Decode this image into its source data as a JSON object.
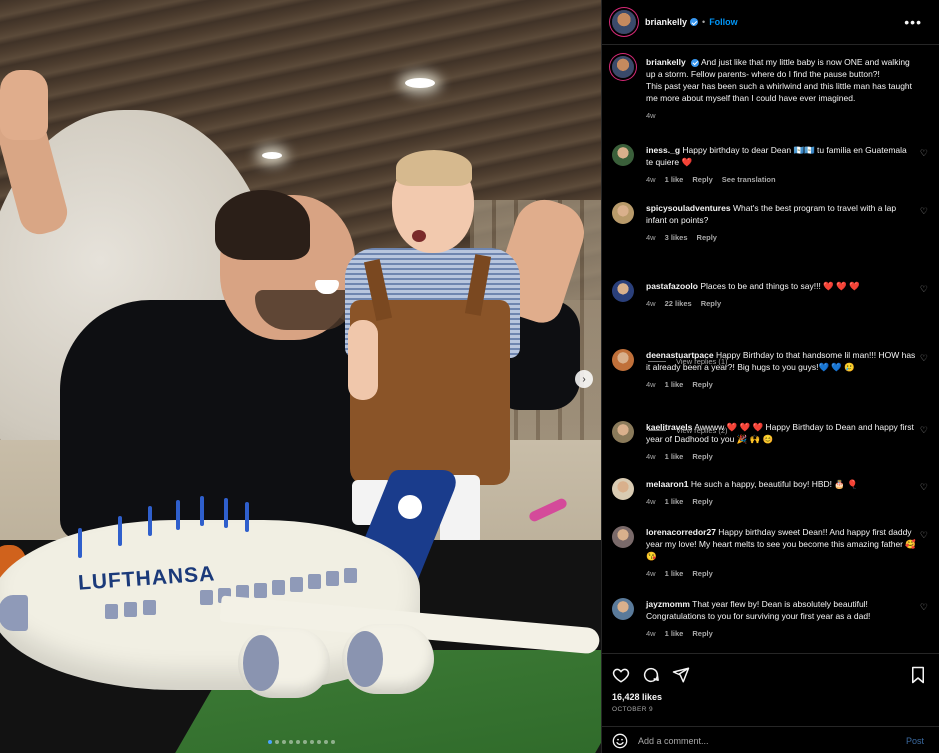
{
  "header": {
    "username": "briankelly",
    "follow_label": "Follow",
    "more_label": "•••"
  },
  "caption": {
    "username": "briankelly",
    "text": "And just like that my little baby is now ONE and walking up a storm. Fellow parents- where do I find the pause button?!\nThis past year has been such a whirlwind and this little man has taught me more about myself than I could have ever imagined.",
    "time": "4w"
  },
  "photo": {
    "cake_logo": "LUFTHANSA",
    "next_icon": "chevron-right-icon",
    "slide_count": 10,
    "active_slide": 1
  },
  "comments": [
    {
      "username": "iness._g",
      "text": "Happy birthday to dear Dean 🇬🇹🇬🇹 tu familia en Guatemala te quiere ❤️",
      "time": "4w",
      "likes": "1 like",
      "reply": "Reply",
      "extra": "See translation",
      "avatar_color": "#3a5f3a"
    },
    {
      "username": "spicysouladventures",
      "text": "What's the best program to travel with a lap infant on points?",
      "time": "4w",
      "likes": "3 likes",
      "reply": "Reply",
      "extra": "",
      "avatar_color": "#b89a6a",
      "replies": "View replies (1)"
    },
    {
      "username": "pastafazoolo",
      "text": "Places to be and things to say!!! ❤️ ❤️ ❤️",
      "time": "4w",
      "likes": "22 likes",
      "reply": "Reply",
      "extra": "",
      "avatar_color": "#2a3f7a",
      "replies": "View replies (2)"
    },
    {
      "username": "deenastuartpace",
      "text": "Happy Birthday to that handsome lil man!!! HOW has it already been a year?! Big hugs to you guys!💙 💙 🥲",
      "time": "4w",
      "likes": "1 like",
      "reply": "Reply",
      "extra": "",
      "avatar_color": "#c0703a"
    },
    {
      "username": "kaelitravels",
      "text": "Awwww ❤️ ❤️ ❤️ Happy Birthday to Dean and happy first year of Dadhood to you 🎉 🙌 😊",
      "time": "4w",
      "likes": "1 like",
      "reply": "Reply",
      "extra": "",
      "avatar_color": "#8a7a5a"
    },
    {
      "username": "melaaron1",
      "text": "He such a happy, beautiful boy! HBD! 🎂 🎈",
      "time": "4w",
      "likes": "1 like",
      "reply": "Reply",
      "extra": "",
      "avatar_color": "#d9cbb2"
    },
    {
      "username": "lorenacorredor27",
      "text": "Happy birthday sweet Dean!! And happy first daddy year my love! My heart melts to see you become this amazing father 🥰 😘",
      "time": "4w",
      "likes": "1 like",
      "reply": "Reply",
      "extra": "",
      "avatar_color": "#7a6a6a"
    },
    {
      "username": "jayzmomm",
      "text": "That year flew by! Dean is absolutely beautiful! Congratulations to you for surviving your first year as a dad!",
      "time": "4w",
      "likes": "1 like",
      "reply": "Reply",
      "extra": "",
      "avatar_color": "#5a7a9a"
    }
  ],
  "footer": {
    "likes": "16,428 likes",
    "date": "OCTOBER 9",
    "comment_placeholder": "Add a comment...",
    "post_label": "Post",
    "icons": [
      "heart-icon",
      "comment-icon",
      "share-icon",
      "bookmark-icon",
      "emoji-icon"
    ]
  },
  "colors": {
    "accent": "#0095f6",
    "verified": "#3897f0",
    "background": "#000000",
    "muted": "#a8a8a8",
    "heart_red": "#ed4956"
  }
}
